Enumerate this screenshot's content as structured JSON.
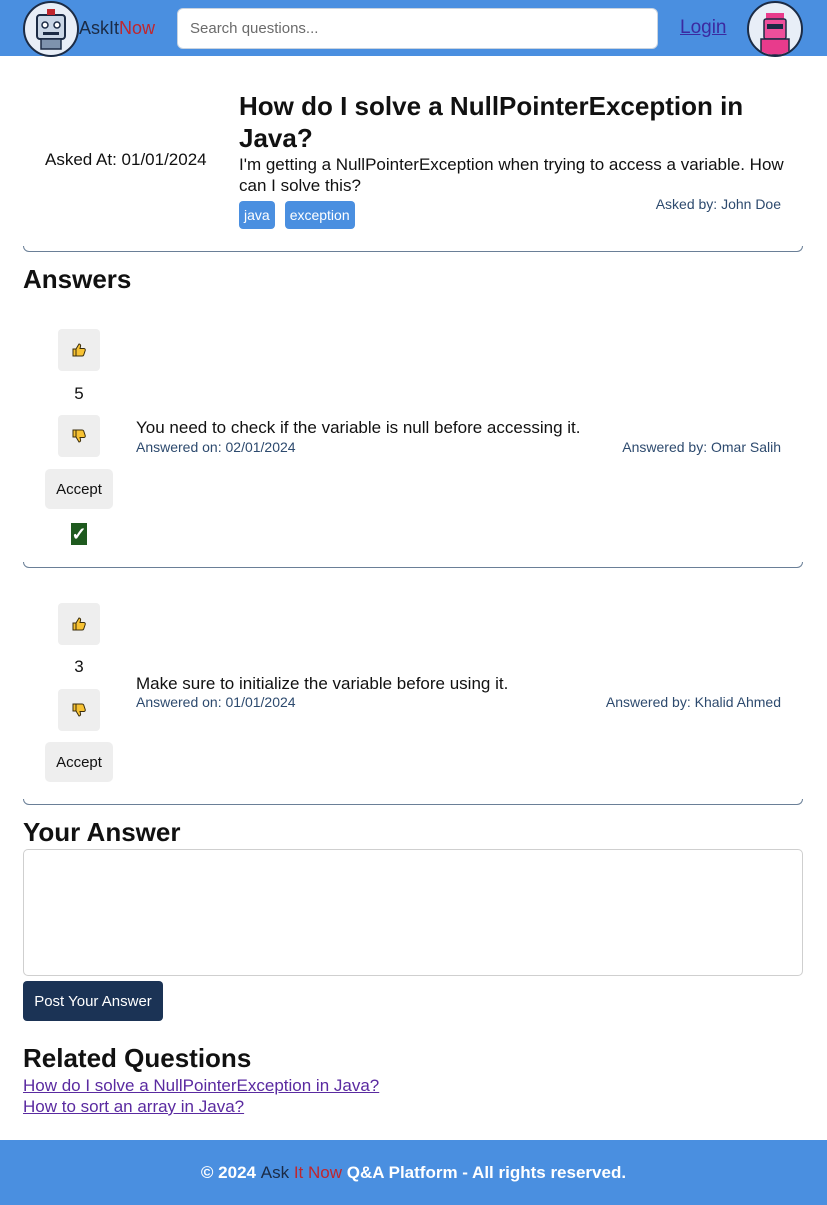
{
  "header": {
    "brand_part1": "AskIt",
    "brand_part2": "Now",
    "search_placeholder": "Search questions...",
    "login_label": "Login"
  },
  "question": {
    "asked_at": "Asked At: 01/01/2024",
    "title": "How do I solve a NullPointerException in Java?",
    "body": "I'm getting a NullPointerException when trying to access a variable. How can I solve this?",
    "tags": [
      "java",
      "exception"
    ],
    "asked_by": "Asked by: John Doe"
  },
  "answers_heading": "Answers",
  "answers": [
    {
      "votes": "5",
      "accept_label": "Accept",
      "accepted": true,
      "body": "You need to check if the variable is null before accessing it.",
      "answered_on": "Answered on: 02/01/2024",
      "answered_by": "Answered by: Omar Salih"
    },
    {
      "votes": "3",
      "accept_label": "Accept",
      "accepted": false,
      "body": "Make sure to initialize the variable before using it.",
      "answered_on": "Answered on: 01/01/2024",
      "answered_by": "Answered by: Khalid Ahmed"
    }
  ],
  "your_answer": {
    "heading": "Your Answer",
    "post_label": "Post Your Answer"
  },
  "related": {
    "heading": "Related Questions",
    "links": [
      "How do I solve a NullPointerException in Java?",
      "How to sort an array in Java?"
    ]
  },
  "footer": {
    "prefix": "© 2024",
    "ask": "Ask",
    "it": "It",
    "now": "Now",
    "suffix": "Q&A Platform - All rights reserved."
  },
  "icons": {
    "upvote": "thumbs-up-icon",
    "downvote": "thumbs-down-icon",
    "accepted": "check-icon"
  },
  "colors": {
    "header_bg": "#4a8fe0",
    "brand_dark": "#1b2b45",
    "brand_red": "#c0262d",
    "post_button": "#1b3355",
    "tag_bg": "#4a8fe0"
  }
}
